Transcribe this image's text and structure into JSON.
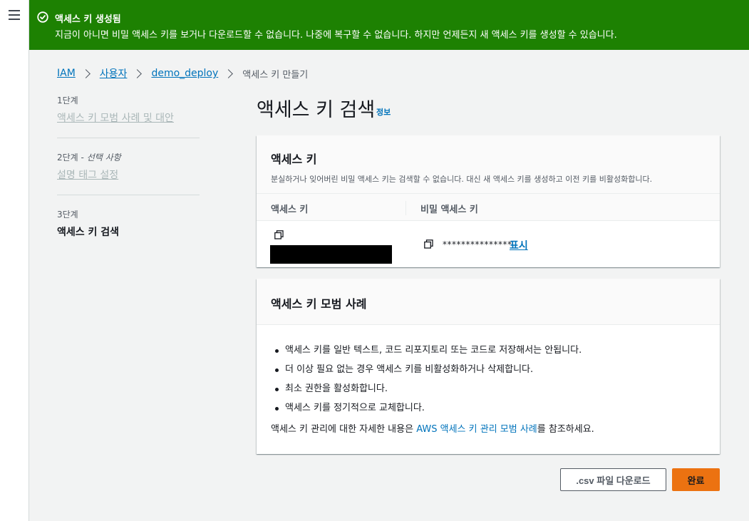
{
  "flash": {
    "title": "액세스 키 생성됨",
    "message": "지금이 아니면 비밀 액세스 키를 보거나 다운로드할 수 없습니다. 나중에 복구할 수 없습니다. 하지만 언제든지 새 액세스 키를 생성할 수 있습니다.",
    "color": "#1d8102",
    "icon": "check-circle-icon"
  },
  "breadcrumb": {
    "items": [
      "IAM",
      "사용자",
      "demo_deploy"
    ],
    "current": "액세스 키 만들기"
  },
  "steps": [
    {
      "num": "1단계",
      "optional": "",
      "title": "액세스 키 모범 사례 및 대안"
    },
    {
      "num": "2단계 - ",
      "optional": "선택 사항",
      "title": "설명 태그 설정"
    },
    {
      "num": "3단계",
      "optional": "",
      "title": "액세스 키 검색"
    }
  ],
  "page": {
    "title": "액세스 키 검색",
    "info": "정보"
  },
  "access_key_card": {
    "heading": "액세스 키",
    "description": "분실하거나 잊어버린 비밀 액세스 키는 검색할 수 없습니다. 대신 새 액세스 키를 생성하고 이전 키를 비활성화합니다.",
    "col_access_key": "액세스 키",
    "col_secret_key": "비밀 액세스 키",
    "secret_mask": "***************",
    "show_label": "표시"
  },
  "best_practices": {
    "heading": "액세스 키 모범 사례",
    "items": [
      "액세스 키를 일반 텍스트, 코드 리포지토리 또는 코드로 저장해서는 안됩니다.",
      "더 이상 필요 없는 경우 액세스 키를 비활성화하거나 삭제합니다.",
      "최소 권한을 활성화합니다.",
      "액세스 키를 정기적으로 교체합니다."
    ],
    "note_prefix": "액세스 키 관리에 대한 자세한 내용은 ",
    "note_link": "AWS 액세스 키 관리 모범 사례",
    "note_suffix": "를 참조하세요."
  },
  "buttons": {
    "download_csv": ".csv 파일 다운로드",
    "done": "완료",
    "primary_color": "#ec7211"
  }
}
